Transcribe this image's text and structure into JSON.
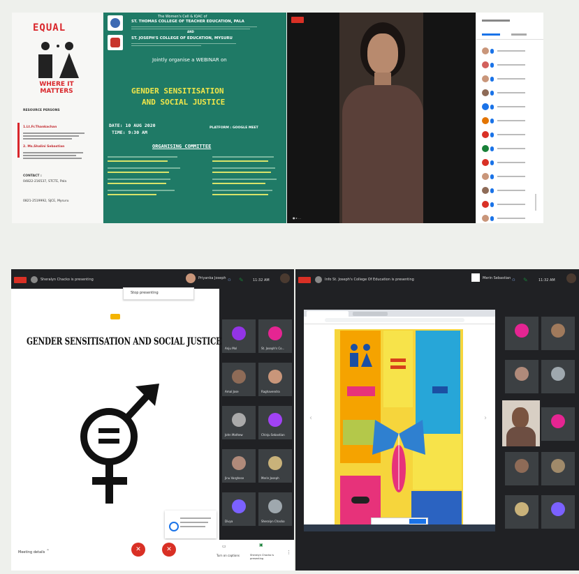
{
  "equal_poster": {
    "title_line1": "EQUAL",
    "title_line2": "WHERE IT MATTERS",
    "section": "RESOURCE PERSONS",
    "person1": "1.Lt.Fr.Thankachan",
    "person2": "2. Ms.Shalini Sebastian",
    "contact_label": "CONTACT :",
    "contact1": "04822-216537, STCTE, Pala",
    "contact2": "0821-2519992, SJCE, Mysuru"
  },
  "webinar_poster": {
    "header1": "The Women's Cell & IQAC of",
    "college1": "ST. THOMAS COLLEGE OF TEACHER EDUCATION, PALA",
    "and": "AND",
    "college2": "ST. JOSEPH'S COLLEGE OF EDUCATION, MYSURU",
    "organise": "Jointly organise a WEBINAR on",
    "topic_line1": "GENDER SENSITISATION",
    "topic_line2": "AND SOCIAL JUSTICE",
    "date": "DATE: 10 AUG 2020",
    "time": "TIME: 9:30 AM",
    "platform": "PLATFORM : GOOGLE MEET",
    "committee": "ORGANISING COMMITTEE"
  },
  "presenter_window": {
    "presenting_text": "Sheralyn Chacko is presenting",
    "presenter_name": "Priyanka Joseph",
    "time": "11:32 AM",
    "banner": "Stop presenting",
    "slide_title": "GENDER SENSITISATION AND SOCIAL JUSTICE",
    "meeting_details": "Meeting details",
    "footer_btn1": "Turn on captions",
    "footer_btn2": "Sheralyn Chacko is presenting",
    "tiles": [
      {
        "name": "Anju Mol"
      },
      {
        "name": "St. Joseph's Co..."
      },
      {
        "name": "Amal Jose"
      },
      {
        "name": "Raghavendra"
      },
      {
        "name": "John Mathew"
      },
      {
        "name": "Chinju Sebastian"
      },
      {
        "name": "Jinu Varghese"
      },
      {
        "name": "Merin Joseph"
      },
      {
        "name": "Divya"
      },
      {
        "name": "Sheralyn Chacko"
      }
    ]
  },
  "second_window": {
    "presenting_text": "Info St. Joseph's College Of Education is presenting",
    "user": "Merin Sebastian",
    "time": "11:32 AM"
  },
  "colors": {
    "poster_green": "#1f7a66",
    "meet_dark": "#202124",
    "record_red": "#d93025",
    "equal_red": "#d9262b"
  }
}
